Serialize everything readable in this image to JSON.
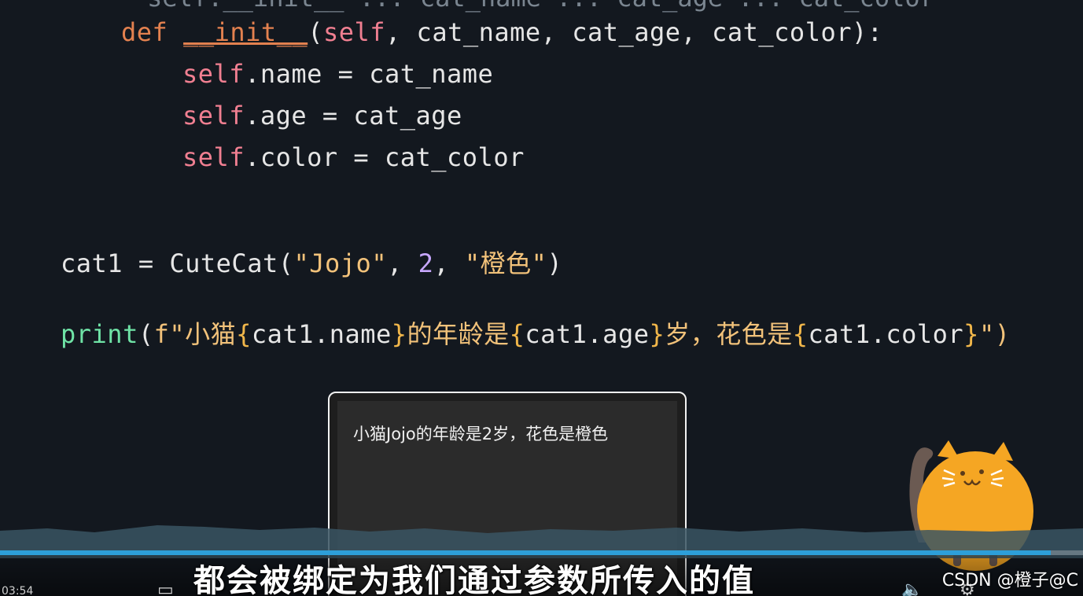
{
  "code": {
    "top_partial": "    self.__init__ ... cat_name ... cat_age ... cat_color",
    "line_def": {
      "kw": "def",
      "fn": "__init__",
      "open": "(",
      "self": "self",
      "params": ", cat_name, cat_age, cat_color):"
    },
    "line_name": {
      "self": "self",
      "rest": ".name = cat_name"
    },
    "line_age": {
      "self": "self",
      "rest": ".age = cat_age"
    },
    "line_color": {
      "self": "self",
      "rest": ".color = cat_color"
    },
    "line_cat1": {
      "a": "cat1 = CuteCat(",
      "s1": "\"Jojo\"",
      "b": ", ",
      "n": "2",
      "c": ", ",
      "s2": "\"橙色\"",
      "d": ")"
    },
    "line_print": {
      "fn": "print",
      "open": "(",
      "f": "f\"小猫",
      "b1o": "{",
      "e1": "cat1.name",
      "b1c": "}",
      "t1": "的年龄是",
      "b2o": "{",
      "e2": "cat1.age",
      "b2c": "}",
      "t2": "岁，花色是",
      "b3o": "{",
      "e3": "cat1.color",
      "b3c": "}",
      "end": "\")"
    }
  },
  "terminal": {
    "output": "小猫Jojo的年龄是2岁，花色是橙色"
  },
  "player": {
    "time": "03:54",
    "progress": 0.97,
    "subtitle": "都会被绑定为我们通过参数所传入的值",
    "watermark": "CSDN @橙子@C"
  },
  "icons": {
    "danmaku": "danmaku-icon",
    "volume": "volume-icon",
    "settings": "gear-icon"
  },
  "colors": {
    "keyword": "#e3814f",
    "self": "#f07f91",
    "string": "#f2c27a",
    "print": "#6fe3a6",
    "progress": "#2d9fd9",
    "cat_body": "#f5a623"
  }
}
